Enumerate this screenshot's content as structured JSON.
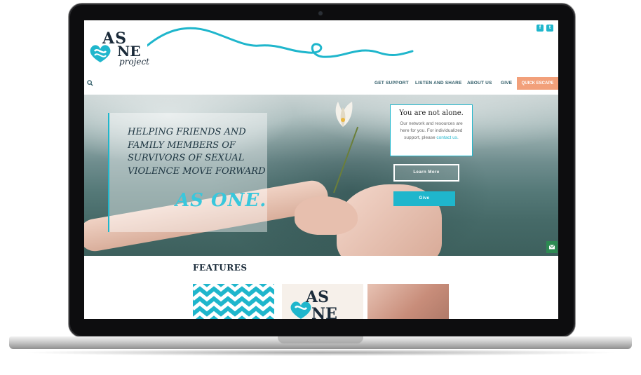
{
  "site": {
    "logo": {
      "line1": "AS",
      "line2": "NE",
      "line3": "project"
    },
    "social": [
      {
        "icon": "facebook-icon",
        "glyph": "f"
      },
      {
        "icon": "twitter-icon",
        "glyph": "t"
      }
    ]
  },
  "nav": {
    "items": [
      "GET SUPPORT",
      "LISTEN AND SHARE",
      "ABOUT US",
      "GIVE"
    ],
    "quick_escape": "QUICK ESCAPE"
  },
  "hero": {
    "headline": "HELPING FRIENDS AND FAMILY MEMBERS OF SURVIVORS OF SEXUAL VIOLENCE MOVE FORWARD",
    "tagline": "AS ONE.",
    "card": {
      "title": "You are not alone.",
      "body": "Our network and resources are here for you.  For individualized support, please",
      "link": "contact us."
    },
    "learn_more": "Learn More",
    "give": "Give"
  },
  "features": {
    "title": "FEATURES",
    "logo_line1": "AS",
    "logo_line2": "NE"
  },
  "colors": {
    "accent": "#1fb6cc",
    "dark": "#1b2b3a",
    "quick_escape": "#f2a07a",
    "mail": "#2c8a52"
  }
}
